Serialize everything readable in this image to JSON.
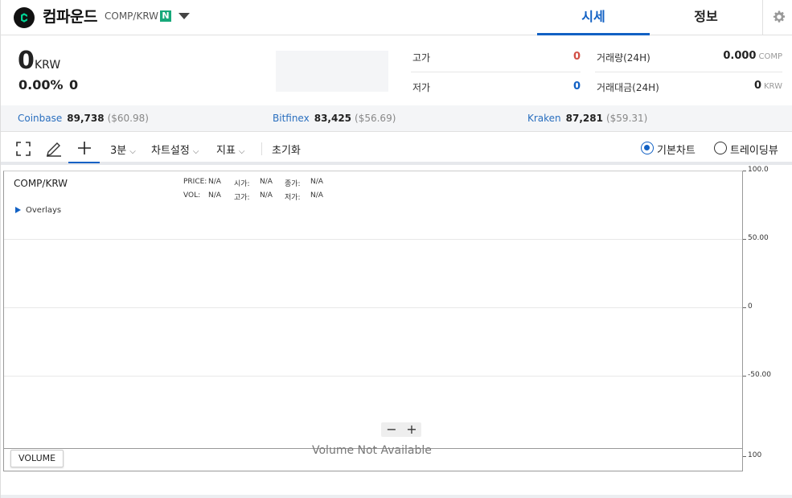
{
  "header": {
    "logo_icon": "compound-logo-icon",
    "coin_name": "컴파운드",
    "pair": "COMP/KRW",
    "badge": "N",
    "tabs": {
      "market": "시세",
      "info": "정보"
    },
    "settings_icon": "gear-icon"
  },
  "summary": {
    "price": "0",
    "unit": "KRW",
    "change_rate": "0.00%",
    "change_price": "0",
    "high_label": "고가",
    "high_value": "0",
    "low_label": "저가",
    "low_value": "0",
    "volume_label": "거래량(24H)",
    "volume_value": "0.000",
    "volume_unit": "COMP",
    "amount_label": "거래대금(24H)",
    "amount_value": "0",
    "amount_unit": "KRW"
  },
  "exchanges": [
    {
      "name": "Coinbase",
      "price": "89,738",
      "usd": "($60.98)"
    },
    {
      "name": "Bitfinex",
      "price": "83,425",
      "usd": "($56.69)"
    },
    {
      "name": "Kraken",
      "price": "87,281",
      "usd": "($59.31)"
    }
  ],
  "toolbar": {
    "interval": "3분",
    "chart_settings": "차트설정",
    "indicators": "지표",
    "reset": "초기화",
    "basic_chart": "기본차트",
    "tradingview": "트레이딩뷰"
  },
  "chart": {
    "pair": "COMP/KRW",
    "price_label": "PRICE:",
    "price_value": "N/A",
    "open_label": "시가:",
    "open_value": "N/A",
    "close_label": "종가:",
    "close_value": "N/A",
    "vol_label": "VOL:",
    "vol_value": "N/A",
    "high_label": "고가:",
    "high_value": "N/A",
    "low_label": "저가:",
    "low_value": "N/A",
    "overlays": "Overlays",
    "y_ticks": [
      "100.0",
      "50.00",
      "0",
      "-50.00",
      "100"
    ],
    "zoom_out": "−",
    "zoom_in": "+",
    "volume_button": "VOLUME",
    "volume_na": "Volume Not Available"
  },
  "colors": {
    "accent": "#1261c4",
    "up": "#d24f45",
    "down": "#1261c4",
    "badge": "#17a87a"
  }
}
